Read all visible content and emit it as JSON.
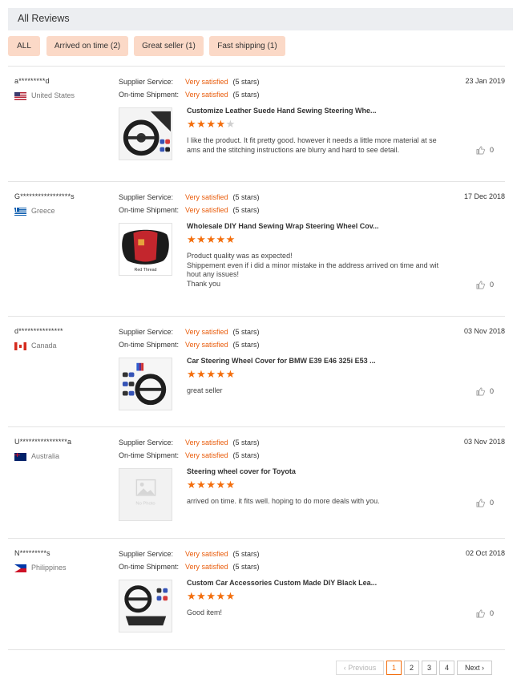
{
  "header": {
    "title": "All Reviews"
  },
  "filters": [
    {
      "label": "ALL"
    },
    {
      "label": "Arrived on time (2)"
    },
    {
      "label": "Great seller (1)"
    },
    {
      "label": "Fast shipping (1)"
    }
  ],
  "labels": {
    "supplier_service": "Supplier Service:",
    "on_time_shipment": "On-time Shipment:"
  },
  "reviews": [
    {
      "user": "a*********d",
      "country": "United States",
      "flag": "us-flag",
      "supplier_rating": "Very satisfied",
      "supplier_stars": "(5 stars)",
      "shipment_rating": "Very satisfied",
      "shipment_stars": "(5 stars)",
      "date": "23 Jan 2019",
      "product": "Customize Leather Suede Hand Sewing Steering Whe...",
      "stars": 4,
      "comment": "I like the product. It fit pretty good. however it needs a little more material at se\nams and the stitching instructions are blurry and hard to see detail.",
      "helpful_count": "0"
    },
    {
      "user": "G*****************s",
      "country": "Greece",
      "flag": "gr-flag",
      "supplier_rating": "Very satisfied",
      "supplier_stars": "(5 stars)",
      "shipment_rating": "Very satisfied",
      "shipment_stars": "(5 stars)",
      "date": "17 Dec 2018",
      "product": "Wholesale DIY Hand Sewing Wrap Steering Wheel Cov...",
      "stars": 5,
      "comment": "Product quality was as expected!\nShippement even if i did a minor mistake in the address arrived on time and wit\nhout any issues!\nThank you",
      "helpful_count": "0",
      "thumb_caption": "Red Thread"
    },
    {
      "user": "d***************",
      "country": "Canada",
      "flag": "ca-flag",
      "supplier_rating": "Very satisfied",
      "supplier_stars": "(5 stars)",
      "shipment_rating": "Very satisfied",
      "shipment_stars": "(5 stars)",
      "date": "03 Nov 2018",
      "product": "Car Steering Wheel Cover for BMW E39 E46 325i E53 ...",
      "stars": 5,
      "comment": "great seller",
      "helpful_count": "0"
    },
    {
      "user": "U****************a",
      "country": "Australia",
      "flag": "au-flag",
      "supplier_rating": "Very satisfied",
      "supplier_stars": "(5 stars)",
      "shipment_rating": "Very satisfied",
      "shipment_stars": "(5 stars)",
      "date": "03 Nov 2018",
      "product": "Steering wheel cover for Toyota",
      "stars": 5,
      "comment": "arrived on time. it fits well. hoping to do more deals with you.",
      "helpful_count": "0",
      "thumb_caption": "No Photo"
    },
    {
      "user": "N*********s",
      "country": "Philippines",
      "flag": "ph-flag",
      "supplier_rating": "Very satisfied",
      "supplier_stars": "(5 stars)",
      "shipment_rating": "Very satisfied",
      "shipment_stars": "(5 stars)",
      "date": "02 Oct 2018",
      "product": "Custom Car Accessories Custom Made DIY Black Lea...",
      "stars": 5,
      "comment": "Good item!",
      "helpful_count": "0"
    }
  ],
  "pagination": {
    "previous": "Previous",
    "pages": [
      "1",
      "2",
      "3",
      "4"
    ],
    "current": "1",
    "next": "Next"
  },
  "colors": {
    "accent": "#f36e0d",
    "filter_bg": "#fbd9c7",
    "rating_text": "#e95c0b"
  }
}
